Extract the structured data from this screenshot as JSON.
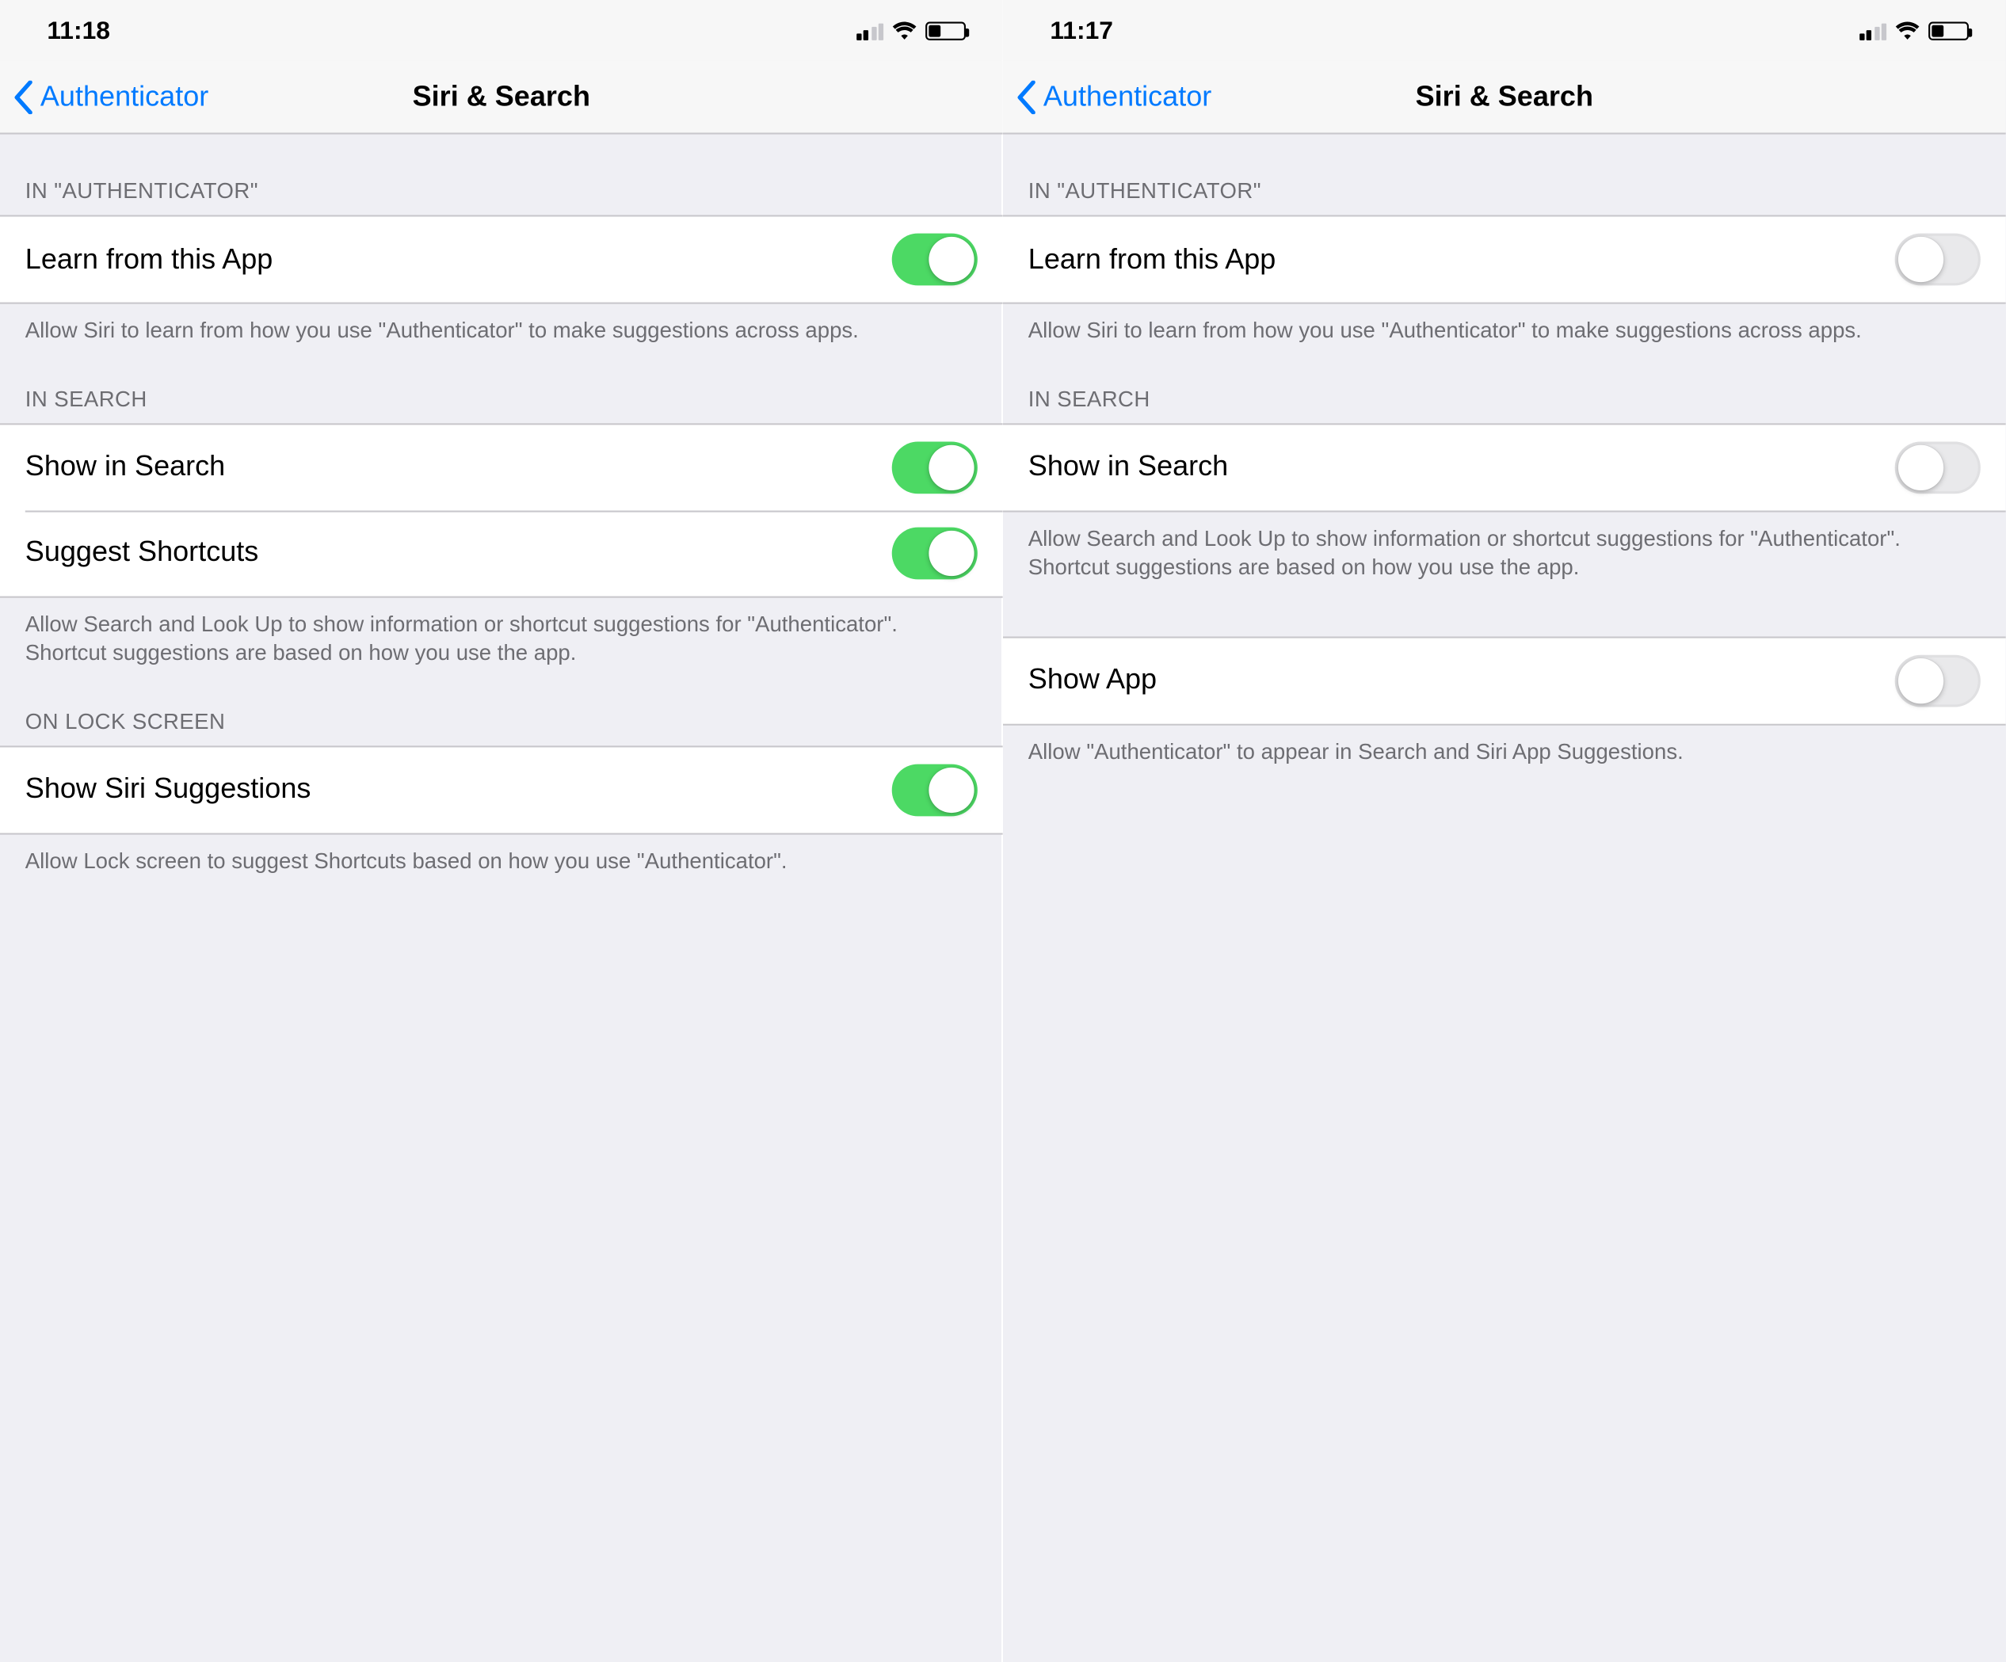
{
  "screens": {
    "left": {
      "status": {
        "time": "11:18"
      },
      "nav": {
        "back": "Authenticator",
        "title": "Siri & Search"
      },
      "sections": [
        {
          "header": "IN \"AUTHENTICATOR\"",
          "rows": [
            {
              "label": "Learn from this App",
              "on": true
            }
          ],
          "footer": "Allow Siri to learn from how you use \"Authenticator\" to make suggestions across apps."
        },
        {
          "header": "IN SEARCH",
          "rows": [
            {
              "label": "Show in Search",
              "on": true
            },
            {
              "label": "Suggest Shortcuts",
              "on": true
            }
          ],
          "footer": "Allow Search and Look Up to show information or shortcut suggestions for \"Authenticator\". Shortcut suggestions are based on how you use the app."
        },
        {
          "header": "ON LOCK SCREEN",
          "rows": [
            {
              "label": "Show Siri Suggestions",
              "on": true
            }
          ],
          "footer": "Allow Lock screen to suggest Shortcuts based on how you use \"Authenticator\"."
        }
      ]
    },
    "right": {
      "status": {
        "time": "11:17"
      },
      "nav": {
        "back": "Authenticator",
        "title": "Siri & Search"
      },
      "sections": [
        {
          "header": "IN \"AUTHENTICATOR\"",
          "rows": [
            {
              "label": "Learn from this App",
              "on": false
            }
          ],
          "footer": "Allow Siri to learn from how you use \"Authenticator\" to make suggestions across apps."
        },
        {
          "header": "IN SEARCH",
          "rows": [
            {
              "label": "Show in Search",
              "on": false
            }
          ],
          "footer": "Allow Search and Look Up to show information or shortcut suggestions for \"Authenticator\". Shortcut suggestions are based on how you use the app."
        },
        {
          "header": "",
          "rows": [
            {
              "label": "Show App",
              "on": false
            }
          ],
          "footer": "Allow \"Authenticator\" to appear in Search and Siri App Suggestions."
        }
      ]
    }
  }
}
